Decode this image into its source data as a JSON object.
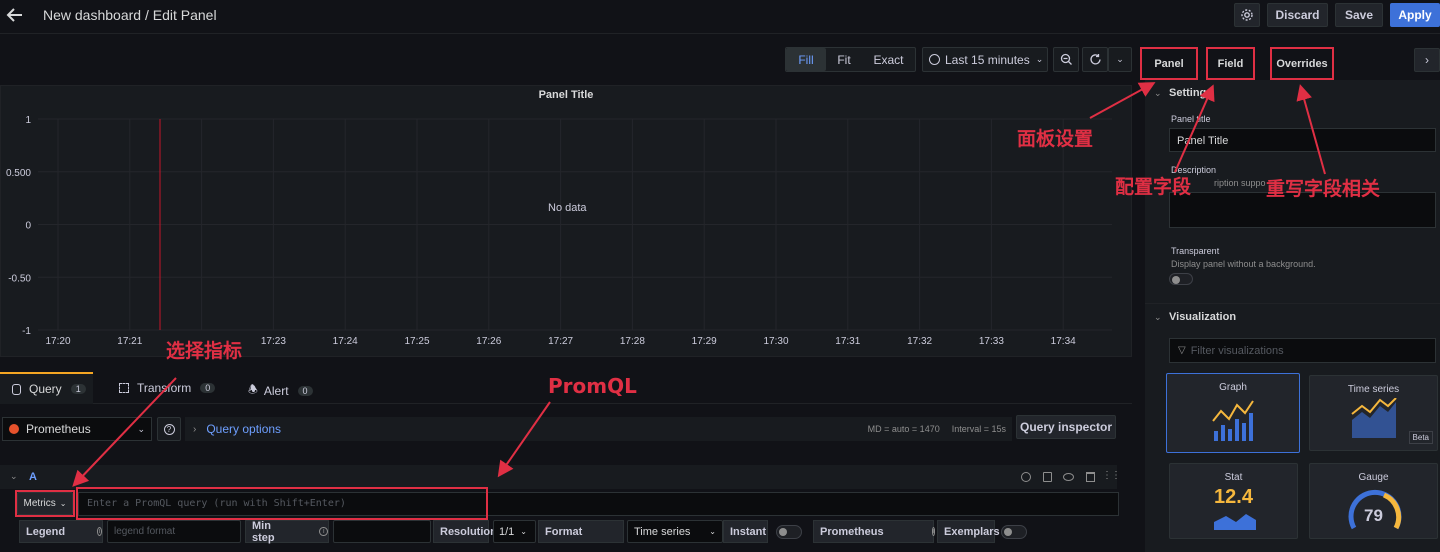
{
  "header": {
    "title": "New dashboard / Edit Panel",
    "discard": "Discard",
    "save": "Save",
    "apply": "Apply"
  },
  "toolbar": {
    "fill": "Fill",
    "fit": "Fit",
    "exact": "Exact",
    "time_range": "Last 15 minutes"
  },
  "panel": {
    "title": "Panel Title",
    "no_data": "No data"
  },
  "chart_data": {
    "type": "line",
    "title": "Panel Title",
    "x": [
      "17:20",
      "17:21",
      "17:22",
      "17:23",
      "17:24",
      "17:25",
      "17:26",
      "17:27",
      "17:28",
      "17:29",
      "17:30",
      "17:31",
      "17:32",
      "17:33",
      "17:34"
    ],
    "y_ticks": [
      "1",
      "0.500",
      "0",
      "-0.50",
      "-1"
    ],
    "x_tick_labels": [
      "17:20",
      "17:21",
      "17:23",
      "17:24",
      "17:25",
      "17:26",
      "17:27",
      "17:28",
      "17:29",
      "17:30",
      "17:31",
      "17:32",
      "17:33",
      "17:34"
    ],
    "ylim": [
      -1,
      1
    ],
    "series": [],
    "annotation": "No data"
  },
  "tabs": [
    {
      "label": "Query",
      "count": "1"
    },
    {
      "label": "Transform",
      "count": "0"
    },
    {
      "label": "Alert",
      "count": "0"
    }
  ],
  "query": {
    "datasource": "Prometheus",
    "options_label": "Query options",
    "md": "MD = auto = 1470",
    "interval": "Interval = 15s",
    "inspector": "Query inspector",
    "row_letter": "A",
    "metrics": "Metrics",
    "placeholder": "Enter a PromQL query (run with Shift+Enter)",
    "legend": "Legend",
    "legend_placeholder": "legend format",
    "min_step": "Min step",
    "resolution": "Resolution",
    "resolution_value": "1/1",
    "format": "Format",
    "format_value": "Time series",
    "instant": "Instant",
    "prometheus": "Prometheus",
    "exemplars": "Exemplars"
  },
  "options_tabs": {
    "panel": "Panel",
    "field": "Field",
    "overrides": "Overrides"
  },
  "settings": {
    "section": "Settings",
    "panel_title_label": "Panel title",
    "panel_title_value": "Panel Title",
    "description_label": "Description",
    "description_hint": "ription suppo",
    "transparent_label": "Transparent",
    "transparent_hint": "Display panel without a background."
  },
  "visualization": {
    "section": "Visualization",
    "filter_placeholder": "Filter visualizations",
    "cards": [
      {
        "label": "Graph"
      },
      {
        "label": "Time series",
        "badge": "Beta"
      },
      {
        "label": "Stat",
        "value": "12.4"
      },
      {
        "label": "Gauge",
        "value": "79"
      }
    ]
  },
  "annotations": {
    "panel_settings": "面板设置",
    "field_config": "配置字段",
    "overrides": "重写字段相关",
    "select_metric": "选择指标",
    "promql": "PromQL"
  },
  "colors": {
    "accent": "#3d71d9",
    "annotation": "#e02f44",
    "link": "#6e9fff"
  }
}
